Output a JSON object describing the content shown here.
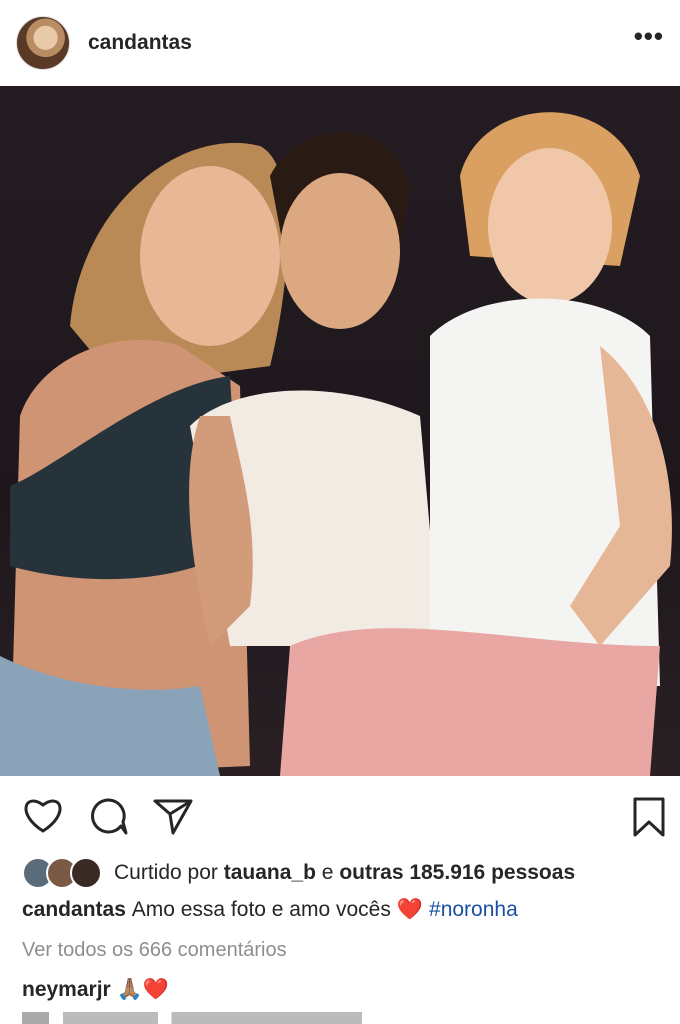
{
  "post": {
    "username": "candantas",
    "more_label": "•••"
  },
  "likes": {
    "prefix": "Curtido por",
    "user": "tauana_b",
    "conjunction": "e",
    "others": "outras 185.916 pessoas"
  },
  "caption": {
    "username": "candantas",
    "text": "Amo essa foto e amo vocês",
    "emoji": "❤️",
    "hashtag": "#noronha"
  },
  "comments": {
    "view_all": "Ver todos os 666 comentários",
    "first": {
      "username": "neymarjr",
      "text": "🙏🏽❤️"
    }
  },
  "icons": [
    "heart-icon",
    "comment-icon",
    "share-icon",
    "bookmark-icon",
    "more-icon"
  ]
}
